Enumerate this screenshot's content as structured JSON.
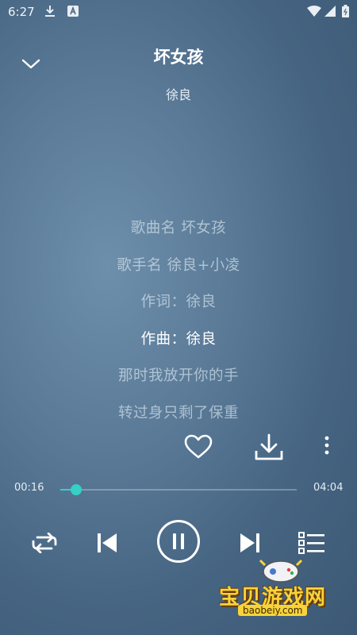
{
  "status_bar": {
    "time": "6:27",
    "icons": [
      "download-icon",
      "a-badge-icon",
      "wifi-icon",
      "signal-icon",
      "battery-icon"
    ]
  },
  "player": {
    "title": "坏女孩",
    "artist": "徐良"
  },
  "lyrics": [
    "歌曲名 坏女孩",
    "歌手名 徐良+小凌",
    "作词：徐良",
    "作曲：徐良",
    "那时我放开你的手",
    "转过身只剩了保重"
  ],
  "active_lyric_index": 3,
  "progress": {
    "current": "00:16",
    "total": "04:04",
    "fraction": 0.066
  },
  "controls": [
    "repeat-icon",
    "previous-icon",
    "pause-icon",
    "next-icon",
    "playlist-icon"
  ],
  "actions": [
    "heart-icon",
    "download-icon",
    "more-icon"
  ],
  "colors": {
    "accent": "#35d0c6",
    "background": "#4f6f8d"
  },
  "watermark": {
    "text": "宝贝游戏网",
    "url": "baobeiy.com"
  }
}
